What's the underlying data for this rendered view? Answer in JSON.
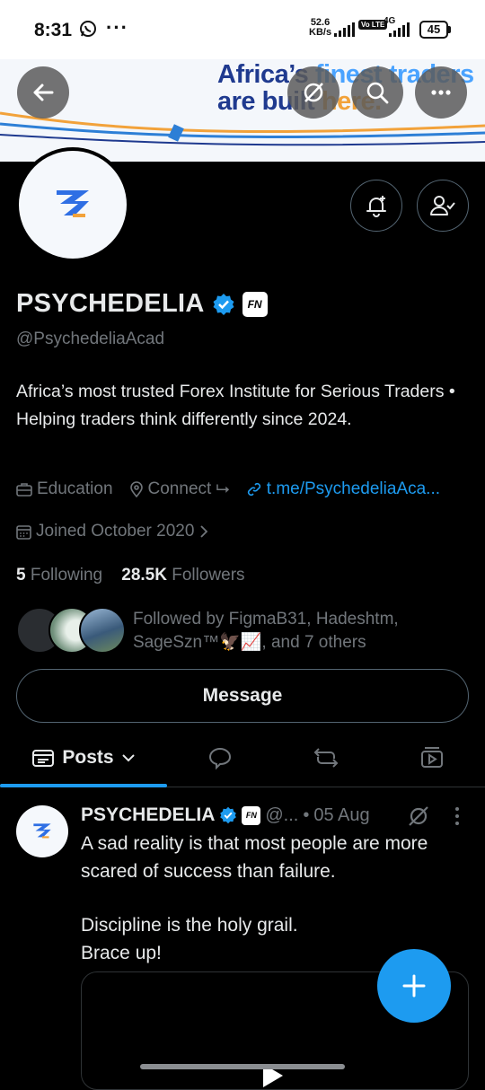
{
  "status_bar": {
    "time": "8:31",
    "speed_value": "52.6",
    "speed_unit": "KB/s",
    "volte": "Vo LTE",
    "network": "4G",
    "battery": "45"
  },
  "banner": {
    "line1_a": "Africa’s ",
    "line1_b": "finest traders",
    "line2_a": "are buil",
    "line2_b": "t ",
    "line2_c": "here."
  },
  "profile": {
    "name": "PSYCHEDELIA",
    "badge": "FN",
    "handle": "@PsychedeliaAcad",
    "bio": "Africa’s most trusted Forex Institute for Serious Traders • Helping traders think differently since 2024.",
    "category": "Education",
    "location": "Connect ⮡",
    "link": "t.me/PsychedeliaAca...",
    "joined": "Joined October 2020",
    "following_count": "5",
    "following_label": "Following",
    "followers_count": "28.5K",
    "followers_label": "Followers",
    "followed_by": "Followed by FigmaB31, Hadeshtm, SageSzn™🦅📈, and 7 others",
    "message_label": "Message"
  },
  "tabs": {
    "posts_label": "Posts"
  },
  "post": {
    "name": "PSYCHEDELIA",
    "badge": "FN",
    "handle": "@...",
    "separator": "•",
    "date": "05 Aug",
    "line1": "A sad reality is that most people are more scared of success than failure.",
    "line2": "Discipline is the holy grail.",
    "line3": "Brace up!"
  },
  "colors": {
    "accent": "#1d9bf0",
    "background": "#000000",
    "text_primary": "#e7e9ea",
    "text_secondary": "#71767b"
  }
}
